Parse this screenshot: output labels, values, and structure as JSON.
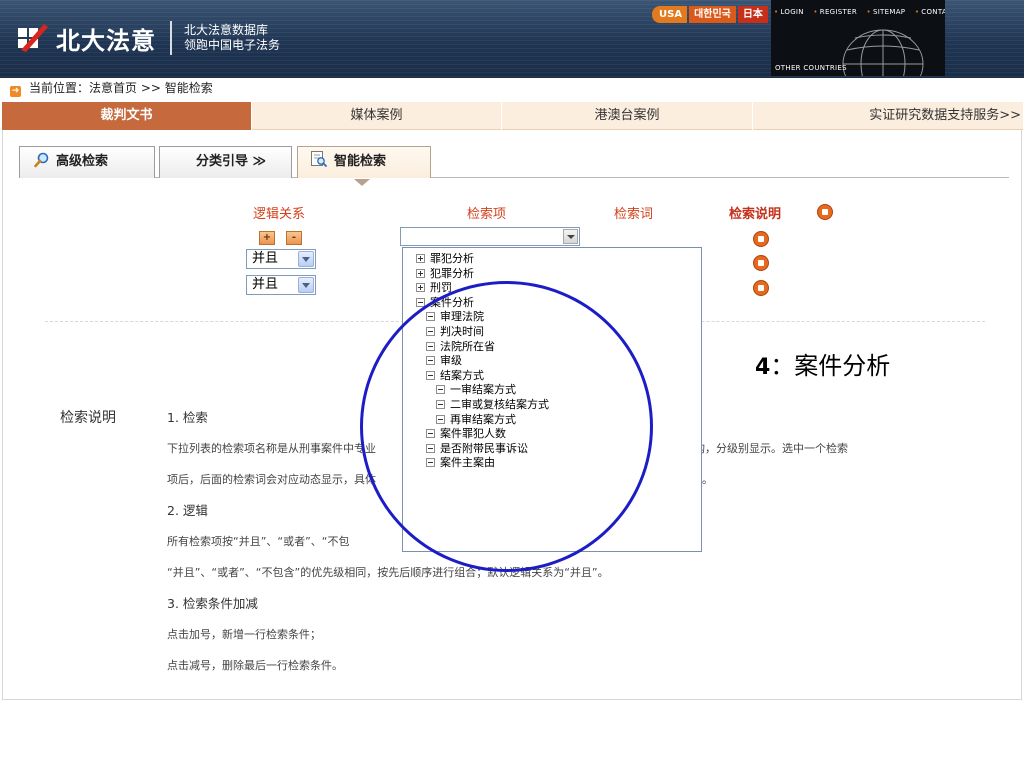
{
  "header": {
    "brand": "北大法意",
    "tagline_line1": "北大法意数据库",
    "tagline_line2": "领跑中国电子法务",
    "languages": [
      "USA",
      "대한민국",
      "日本"
    ],
    "top_links": [
      "LOGIN",
      "REGISTER",
      "SITEMAP",
      "CONTACT US"
    ],
    "other_countries": "OTHER COUNTRIES"
  },
  "breadcrumb": {
    "prefix": "当前位置：",
    "home": "法意首页",
    "separator": ">>",
    "current": "智能检索"
  },
  "main_tabs": [
    {
      "label": "裁判文书",
      "active": true
    },
    {
      "label": "媒体案例",
      "active": false
    },
    {
      "label": "港澳台案例",
      "active": false
    },
    {
      "label": "实证研究数据支持服务>>",
      "active": false
    }
  ],
  "sub_tabs": [
    {
      "label": "高级检索",
      "icon": "magnifier-icon"
    },
    {
      "label": "分类引导",
      "icon": "double-chevron-icon",
      "suffix": "≫"
    },
    {
      "label": "智能检索",
      "icon": "document-search-icon",
      "active": true
    }
  ],
  "form": {
    "col_logic": "逻辑关系",
    "col_item": "检索项",
    "col_word": "检索词",
    "col_help": "检索说明",
    "plus": "+",
    "minus": "-",
    "logic_values": [
      "并且",
      "并且"
    ],
    "combo_value": ""
  },
  "tree": [
    {
      "label": "罪犯分析",
      "level": 0,
      "expanded": false
    },
    {
      "label": "犯罪分析",
      "level": 0,
      "expanded": false
    },
    {
      "label": "刑罚",
      "level": 0,
      "expanded": false
    },
    {
      "label": "案件分析",
      "level": 0,
      "expanded": true
    },
    {
      "label": "审理法院",
      "level": 1
    },
    {
      "label": "判决时间",
      "level": 1
    },
    {
      "label": "法院所在省",
      "level": 1
    },
    {
      "label": "审级",
      "level": 1
    },
    {
      "label": "结案方式",
      "level": 1,
      "expanded": true
    },
    {
      "label": "一审结案方式",
      "level": 2
    },
    {
      "label": "二审或复核结案方式",
      "level": 2
    },
    {
      "label": "再审结案方式",
      "level": 2
    },
    {
      "label": "案件罪犯人数",
      "level": 1
    },
    {
      "label": "是否附带民事诉讼",
      "level": 1
    },
    {
      "label": "案件主案由",
      "level": 1
    }
  ],
  "annotation": {
    "num": "4",
    "text": "：案件分析"
  },
  "explanation": {
    "title": "检索说明",
    "h1": "1. 检索",
    "p1": "下拉列表的检索项名称是从刑事案件中专业",
    "p1_tail": "构，分级别显示。选中一个检索",
    "p2": "项后，后面的检索词会对应动态显示，具体",
    "p2_tail": "等等。",
    "h2": "2. 逻辑",
    "p3": "所有检索项按“并且”、“或者”、“不包",
    "p4": "“并且”、“或者”、“不包含”的优先级相同，按先后顺序进行组合；默认逻辑关系为“并且”。",
    "h3": "3. 检索条件加减",
    "p5": "点击加号，新增一行检索条件；",
    "p6": "点击减号，删除最后一行检索条件。"
  },
  "colors": {
    "header_bg": "#1f3553",
    "accent_orange": "#c66a3e",
    "tab_bg": "#fbeede",
    "label_red": "#d3401a",
    "circle_blue": "#1d1dc5"
  }
}
